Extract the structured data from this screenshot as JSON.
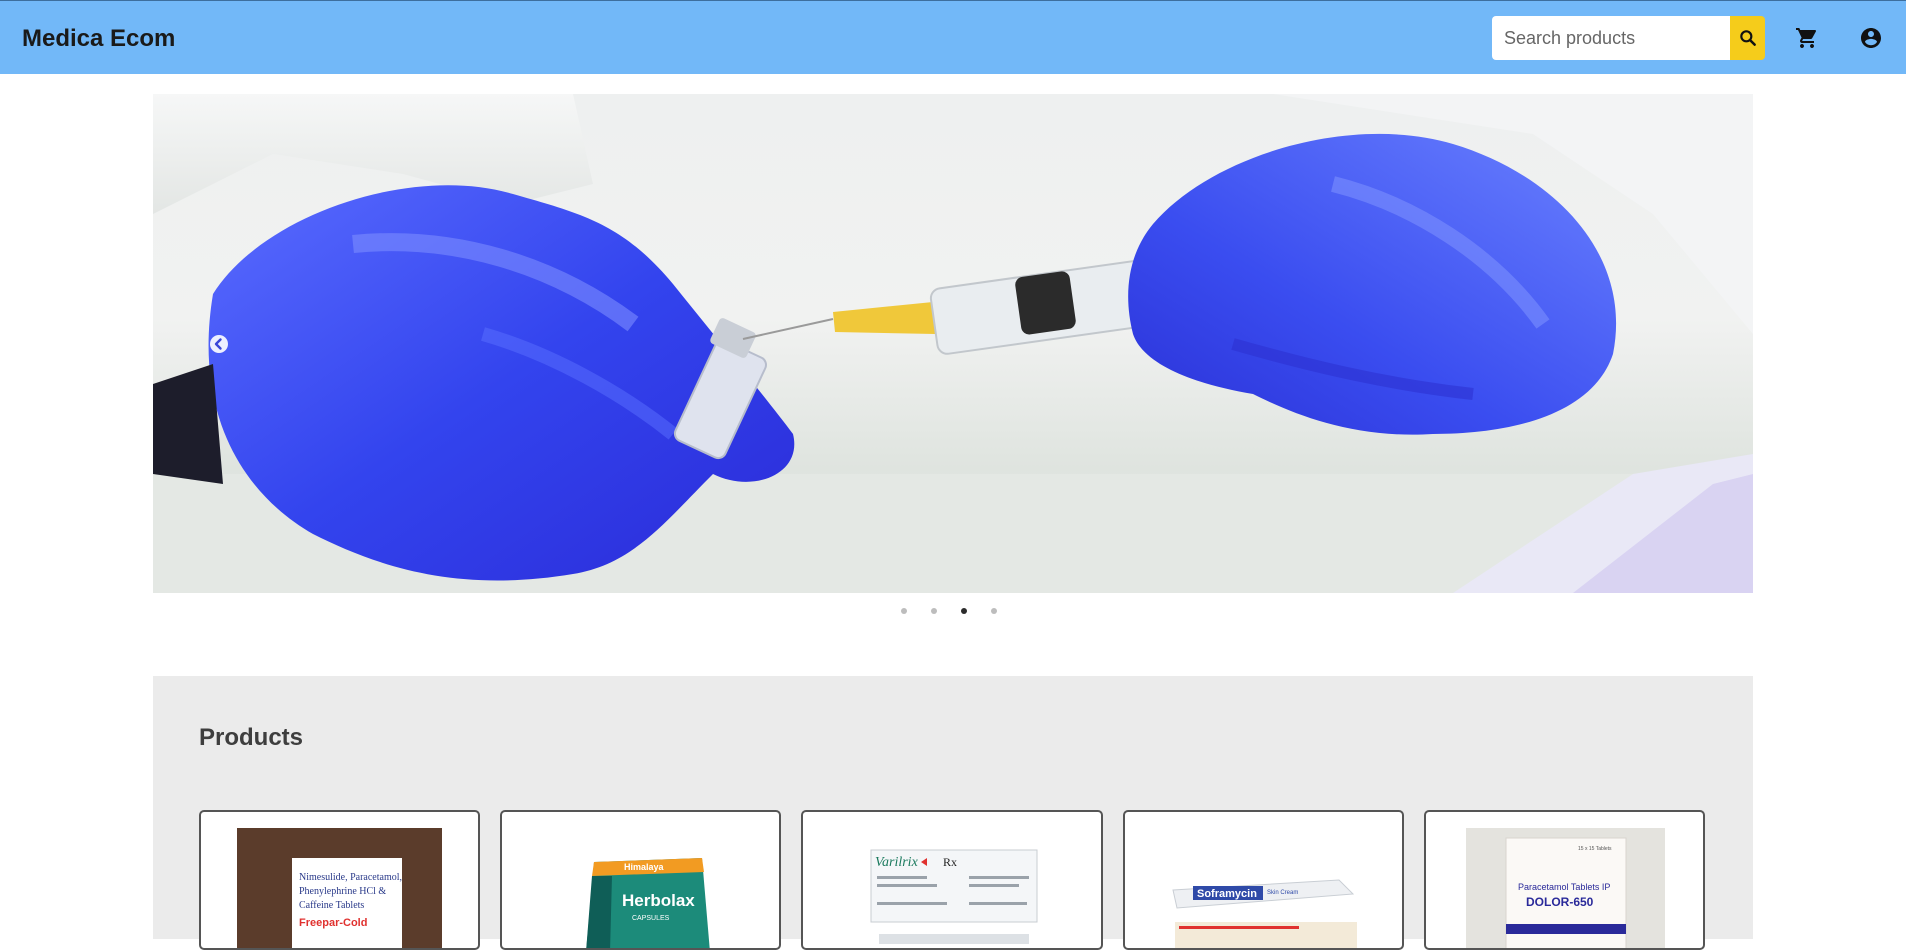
{
  "header": {
    "brand": "Medica Ecom",
    "search": {
      "placeholder": "Search products",
      "value": ""
    },
    "icons": {
      "search": "search-icon",
      "cart": "cart-icon",
      "account": "account-circle-icon"
    },
    "colors": {
      "navbar": "#72b8f8",
      "search_button": "#f5cc1b"
    }
  },
  "carousel": {
    "slide_count": 4,
    "active_index": 2,
    "prev_icon": "chevron-left-circle-icon",
    "slide_description_icon": "syringe-and-vial-image"
  },
  "products": {
    "title": "Products",
    "items": [
      {
        "name_icon": "freepar-cold-box",
        "package_text": [
          "Nimesulide, Paracetamol,",
          "Phenylephrine HCl &",
          "Caffeine Tablets",
          "Freepar-Cold"
        ]
      },
      {
        "name_icon": "himalaya-herbolax-box",
        "package_text": [
          "Himalaya",
          "Herbolax",
          "CAPSULES"
        ]
      },
      {
        "name_icon": "varilrix-box",
        "package_text": [
          "Varilrix",
          "Rx"
        ]
      },
      {
        "name_icon": "soframycin-tube",
        "package_text": [
          "Soframycin",
          "Skin Cream"
        ]
      },
      {
        "name_icon": "dolor-650-box",
        "package_text": [
          "Paracetamol Tablets IP",
          "DOLOR-650",
          "15 x 15 Tablets"
        ]
      }
    ]
  }
}
